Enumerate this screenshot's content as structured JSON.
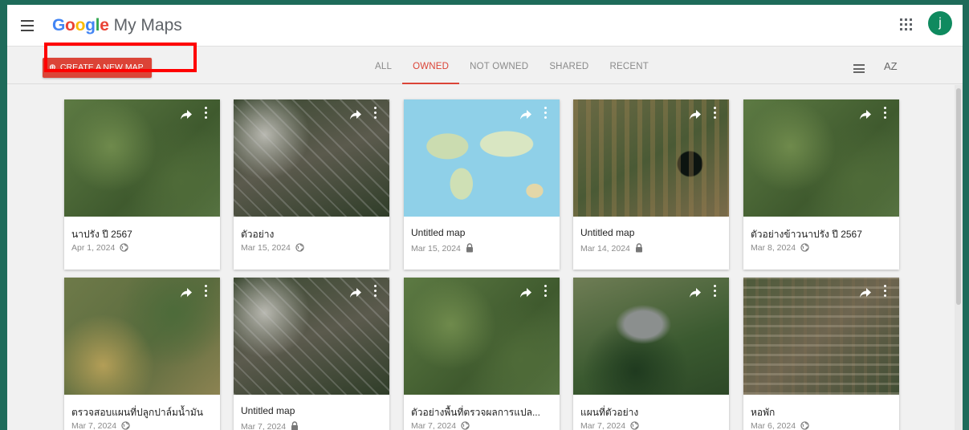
{
  "header": {
    "menu_icon": "hamburger-icon",
    "brand_letters": [
      "G",
      "o",
      "o",
      "g",
      "l",
      "e"
    ],
    "product": "My Maps",
    "apps_icon": "apps-grid-icon",
    "avatar_initial": "j",
    "avatar_color": "#0f8a5f"
  },
  "toolbar": {
    "create_label": "CREATE A NEW MAP",
    "create_icon": "add-map-icon",
    "tabs": [
      {
        "label": "ALL",
        "active": false
      },
      {
        "label": "OWNED",
        "active": true
      },
      {
        "label": "NOT OWNED",
        "active": false
      },
      {
        "label": "SHARED",
        "active": false
      },
      {
        "label": "RECENT",
        "active": false
      }
    ],
    "list_view_icon": "list-view-icon",
    "sort_label": "AZ"
  },
  "colors": {
    "accent": "#db4437",
    "highlight_box": "#ff0000",
    "frame": "#1e6b5a"
  },
  "maps": [
    {
      "title": "นาปรัง ปี 2567",
      "date": "Apr 1, 2024",
      "visibility": "public",
      "thumb": "satellite-green"
    },
    {
      "title": "ตัวอย่าง",
      "date": "Mar 15, 2024",
      "visibility": "public",
      "thumb": "satellite-town"
    },
    {
      "title": "Untitled map",
      "date": "Mar 15, 2024",
      "visibility": "private",
      "thumb": "world-map"
    },
    {
      "title": "Untitled map",
      "date": "Mar 14, 2024",
      "visibility": "private",
      "thumb": "satellite-fields"
    },
    {
      "title": "ตัวอย่างข้าวนาปรัง ปี 2567",
      "date": "Mar 8, 2024",
      "visibility": "public",
      "thumb": "satellite-green"
    },
    {
      "title": "ตรวจสอบแผนที่ปลูกปาล์มน้ำมัน",
      "date": "Mar 7, 2024",
      "visibility": "public",
      "thumb": "satellite-yellow"
    },
    {
      "title": "Untitled map",
      "date": "Mar 7, 2024",
      "visibility": "private",
      "thumb": "satellite-town"
    },
    {
      "title": "ตัวอย่างพื้นที่ตรวจผลการแปล...",
      "date": "Mar 7, 2024",
      "visibility": "public",
      "thumb": "satellite-green"
    },
    {
      "title": "แผนที่ตัวอย่าง",
      "date": "Mar 7, 2024",
      "visibility": "public",
      "thumb": "satellite-forest"
    },
    {
      "title": "หอพัก",
      "date": "Mar 6, 2024",
      "visibility": "public",
      "thumb": "satellite-urban"
    }
  ]
}
